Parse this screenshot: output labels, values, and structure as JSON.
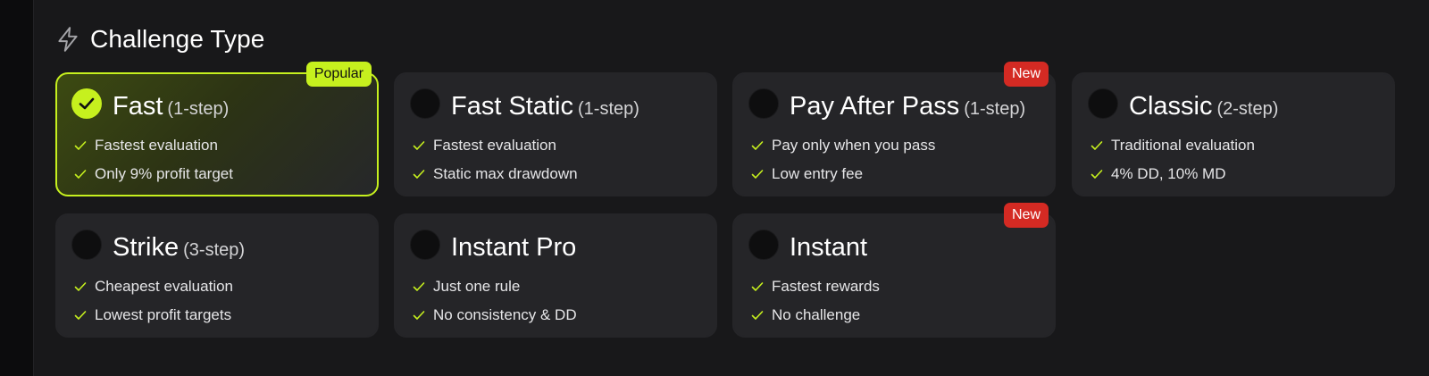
{
  "section": {
    "title": "Challenge Type",
    "icon": "lightning-bolt-icon"
  },
  "colors": {
    "accent": "#c6f01e",
    "new_badge": "#d42a23",
    "card_bg": "#252528",
    "panel_bg": "#18181a"
  },
  "cards": [
    {
      "title": "Fast",
      "subtitle": "(1-step)",
      "badge": "Popular",
      "selected": true,
      "features": [
        "Fastest evaluation",
        "Only 9% profit target"
      ]
    },
    {
      "title": "Fast Static",
      "subtitle": "(1-step)",
      "badge": "",
      "selected": false,
      "features": [
        "Fastest evaluation",
        "Static max drawdown"
      ]
    },
    {
      "title": "Pay After Pass",
      "subtitle": "(1-step)",
      "badge": "New",
      "selected": false,
      "features": [
        "Pay only when you pass",
        "Low entry fee"
      ]
    },
    {
      "title": "Classic",
      "subtitle": "(2-step)",
      "badge": "",
      "selected": false,
      "features": [
        "Traditional evaluation",
        "4% DD, 10% MD"
      ]
    },
    {
      "title": "Strike",
      "subtitle": "(3-step)",
      "badge": "",
      "selected": false,
      "features": [
        "Cheapest evaluation",
        "Lowest profit targets"
      ]
    },
    {
      "title": "Instant Pro",
      "subtitle": "",
      "badge": "",
      "selected": false,
      "features": [
        "Just one rule",
        "No consistency & DD"
      ]
    },
    {
      "title": "Instant",
      "subtitle": "",
      "badge": "New",
      "selected": false,
      "features": [
        "Fastest rewards",
        "No challenge"
      ]
    }
  ]
}
